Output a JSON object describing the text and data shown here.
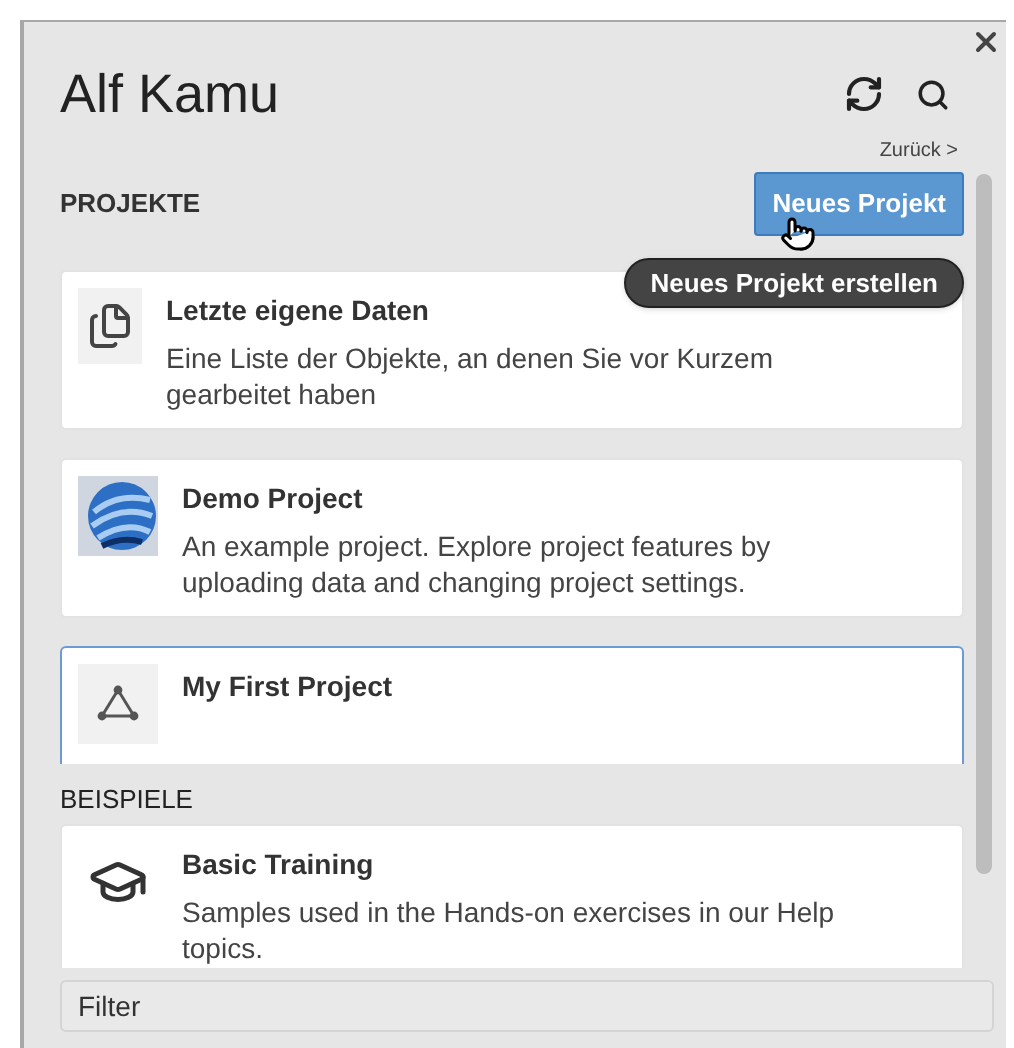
{
  "header": {
    "title": "Alf Kamu",
    "back_link": "Zurück >"
  },
  "projects": {
    "heading": "PROJEKTE",
    "new_button": "Neues Projekt",
    "tooltip": "Neues Projekt erstellen",
    "items": [
      {
        "kind": "recent",
        "title": "Letzte eigene Daten",
        "description": "Eine Liste der Objekte, an denen Sie vor Kurzem gearbeitet haben",
        "selected": false
      },
      {
        "kind": "demo",
        "title": "Demo Project",
        "description": "An example project. Explore project features by uploading data and changing project settings.",
        "selected": false
      },
      {
        "kind": "project",
        "title": "My First Project",
        "selected": true
      }
    ]
  },
  "examples": {
    "heading": "BEISPIELE",
    "items": [
      {
        "kind": "training",
        "title": "Basic Training",
        "description": "Samples used in the Hands-on exercises in our Help topics.",
        "selected": false
      }
    ]
  },
  "filter": {
    "placeholder": "Filter"
  }
}
